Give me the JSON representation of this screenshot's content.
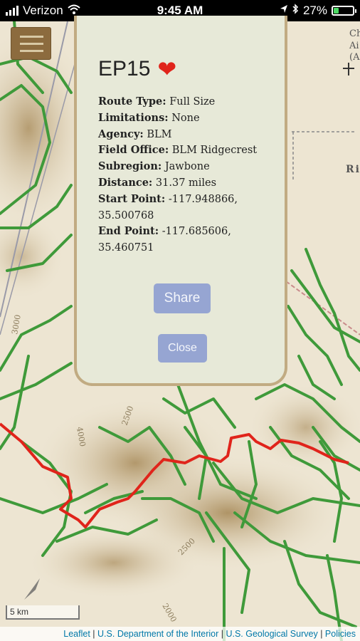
{
  "status_bar": {
    "carrier": "Verizon",
    "time": "9:45 AM",
    "battery": "27%",
    "battery_level": 0.27
  },
  "map": {
    "labels": [
      "Ch",
      "Ai",
      "(A",
      "Ri"
    ],
    "scale_label": "5 km",
    "contour_labels": [
      "3000",
      "4000",
      "2500",
      "2500",
      "2000"
    ],
    "colors": {
      "trails": "#3f9a3a",
      "route": "#e0241b",
      "terrain": "#e9dfc9"
    }
  },
  "menu": {
    "icon": "hamburger-menu-icon"
  },
  "popup": {
    "title": "EP15",
    "favorite_icon": "heart-icon",
    "details": [
      {
        "label": "Route Type:",
        "value": "Full Size"
      },
      {
        "label": "Limitations:",
        "value": "None"
      },
      {
        "label": "Agency:",
        "value": "BLM"
      },
      {
        "label": "Field Office:",
        "value": "BLM Ridgecrest"
      },
      {
        "label": "Subregion:",
        "value": "Jawbone"
      },
      {
        "label": "Distance:",
        "value": "31.37 miles"
      },
      {
        "label": "Start Point:",
        "value": "-117.948866, 35.500768"
      },
      {
        "label": "End Point:",
        "value": "-117.685606, 35.460751"
      }
    ],
    "share_label": "Share",
    "close_label": "Close"
  },
  "attribution": {
    "links": [
      "Leaflet",
      "U.S. Department of the Interior",
      "U.S. Geological Survey",
      "Policies"
    ],
    "separator": "|"
  }
}
